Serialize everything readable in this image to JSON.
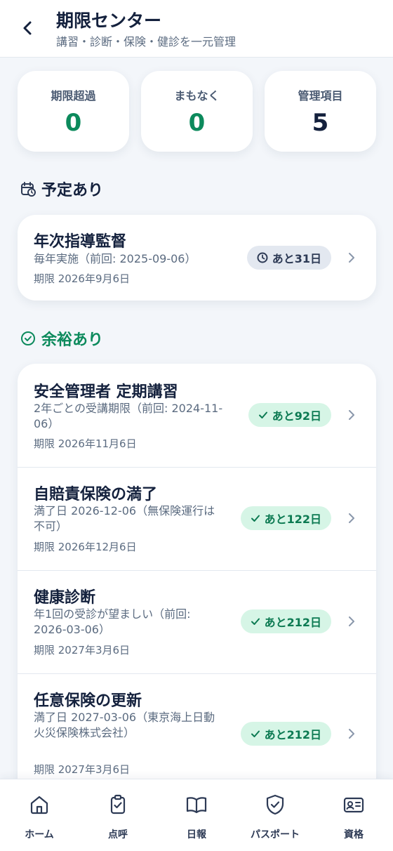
{
  "header": {
    "title": "期限センター",
    "subtitle": "講習・診断・保険・健診を一元管理"
  },
  "stats": [
    {
      "label": "期限超過",
      "value": "0"
    },
    {
      "label": "まもなく",
      "value": "0"
    },
    {
      "label": "管理項目",
      "value": "5"
    }
  ],
  "sections": {
    "scheduled": {
      "title": "予定あり",
      "items": [
        {
          "title": "年次指導監督",
          "desc": "毎年実施（前回: 2025-09-06）",
          "due": "期限 2026年9月6日",
          "badge": "あと31日"
        }
      ]
    },
    "margin": {
      "title": "余裕あり",
      "items": [
        {
          "title": "安全管理者 定期講習",
          "desc": "2年ごとの受講期限（前回: 2024-11-06）",
          "due": "期限 2026年11月6日",
          "badge": "あと92日"
        },
        {
          "title": "自賠責保険の満了",
          "desc": "満了日 2026-12-06（無保険運行は不可）",
          "due": "期限 2026年12月6日",
          "badge": "あと122日"
        },
        {
          "title": "健康診断",
          "desc": "年1回の受診が望ましい（前回: 2026-03-06）",
          "due": "期限 2027年3月6日",
          "badge": "あと212日"
        },
        {
          "title": "任意保険の更新",
          "desc": "満了日 2027-03-06（東京海上日動火災保険株式会社）",
          "due": "期限 2027年3月6日",
          "badge": "あと212日"
        }
      ]
    }
  },
  "nav": [
    {
      "label": "ホーム",
      "icon": "home-icon"
    },
    {
      "label": "点呼",
      "icon": "clipboard-check-icon"
    },
    {
      "label": "日報",
      "icon": "book-icon"
    },
    {
      "label": "パスポート",
      "icon": "shield-check-icon"
    },
    {
      "label": "資格",
      "icon": "id-card-icon"
    }
  ],
  "colors": {
    "accent_green": "#0c8a5c",
    "navy": "#14213d",
    "badge_mint": "#d6f5e6",
    "badge_gray": "#e3e8f0"
  }
}
